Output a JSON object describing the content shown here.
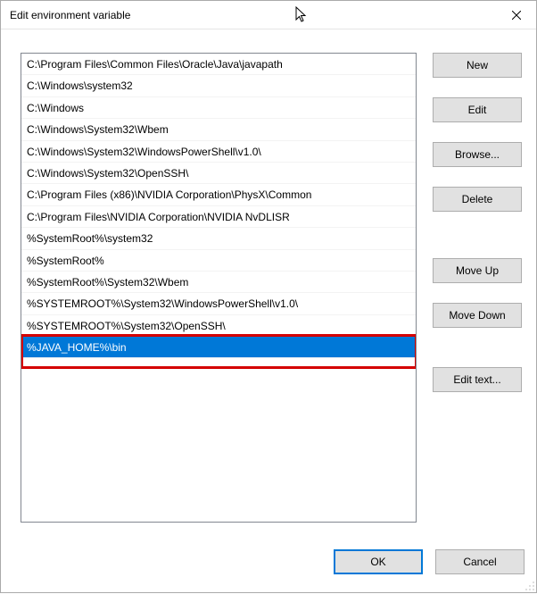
{
  "window": {
    "title": "Edit environment variable"
  },
  "entries": [
    "C:\\Program Files\\Common Files\\Oracle\\Java\\javapath",
    "C:\\Windows\\system32",
    "C:\\Windows",
    "C:\\Windows\\System32\\Wbem",
    "C:\\Windows\\System32\\WindowsPowerShell\\v1.0\\",
    "C:\\Windows\\System32\\OpenSSH\\",
    "C:\\Program Files (x86)\\NVIDIA Corporation\\PhysX\\Common",
    "C:\\Program Files\\NVIDIA Corporation\\NVIDIA NvDLISR",
    "%SystemRoot%\\system32",
    "%SystemRoot%",
    "%SystemRoot%\\System32\\Wbem",
    "%SYSTEMROOT%\\System32\\WindowsPowerShell\\v1.0\\",
    "%SYSTEMROOT%\\System32\\OpenSSH\\",
    "%JAVA_HOME%\\bin"
  ],
  "selected_index": 13,
  "buttons": {
    "new": "New",
    "edit": "Edit",
    "browse": "Browse...",
    "delete": "Delete",
    "move_up": "Move Up",
    "move_down": "Move Down",
    "edit_text": "Edit text...",
    "ok": "OK",
    "cancel": "Cancel"
  }
}
